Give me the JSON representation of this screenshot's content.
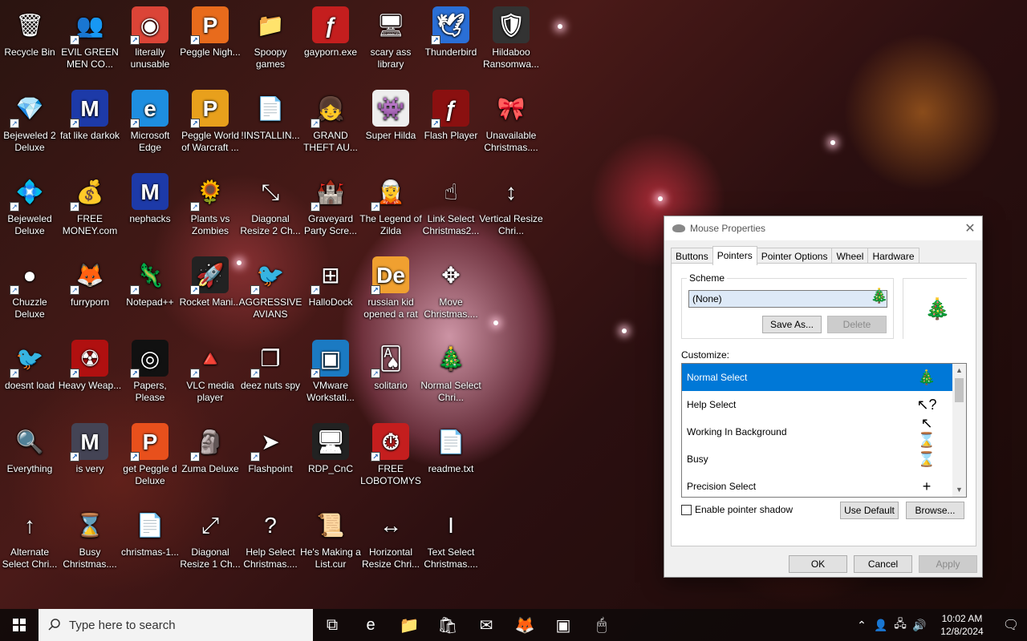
{
  "desktop": {
    "icons": [
      {
        "label": "Recycle Bin",
        "glyph": "🗑",
        "bg": "",
        "col": 0,
        "row": 0,
        "shortcut": false
      },
      {
        "label": "EVIL GREEN MEN CO...",
        "glyph": "👥",
        "bg": "",
        "col": 1,
        "row": 0,
        "shortcut": true
      },
      {
        "label": "literally unusable",
        "glyph": "◉",
        "bg": "#db4437",
        "col": 2,
        "row": 0,
        "shortcut": true
      },
      {
        "label": "Peggle Nigh...",
        "glyph": "P",
        "bg": "#e86b1c",
        "col": 3,
        "row": 0,
        "shortcut": true
      },
      {
        "label": "Spoopy games",
        "glyph": "📁",
        "bg": "",
        "col": 4,
        "row": 0,
        "shortcut": false
      },
      {
        "label": "gayporn.exe",
        "glyph": "ƒ",
        "bg": "#c41e1e",
        "col": 5,
        "row": 0,
        "shortcut": false
      },
      {
        "label": "scary ass library",
        "glyph": "🖥",
        "bg": "",
        "col": 6,
        "row": 0,
        "shortcut": false
      },
      {
        "label": "Thunderbird",
        "glyph": "🕊",
        "bg": "#2a6fd6",
        "col": 7,
        "row": 0,
        "shortcut": true
      },
      {
        "label": "Hildaboo Ransomwa...",
        "glyph": "🛡",
        "bg": "#333",
        "col": 8,
        "row": 0,
        "shortcut": false
      },
      {
        "label": "Bejeweled 2 Deluxe",
        "glyph": "💎",
        "bg": "",
        "col": 0,
        "row": 1,
        "shortcut": true
      },
      {
        "label": "fat like darkok",
        "glyph": "M",
        "bg": "#1d3aa8",
        "col": 1,
        "row": 1,
        "shortcut": true
      },
      {
        "label": "Microsoft Edge",
        "glyph": "e",
        "bg": "#1e8ee0",
        "col": 2,
        "row": 1,
        "shortcut": true
      },
      {
        "label": "Peggle World of Warcraft ...",
        "glyph": "P",
        "bg": "#e8a01c",
        "col": 3,
        "row": 1,
        "shortcut": true
      },
      {
        "label": "!INSTALLIN...",
        "glyph": "📄",
        "bg": "",
        "col": 4,
        "row": 1,
        "shortcut": false
      },
      {
        "label": "GRAND THEFT AU...",
        "glyph": "👧",
        "bg": "",
        "col": 5,
        "row": 1,
        "shortcut": true
      },
      {
        "label": "Super Hilda",
        "glyph": "👾",
        "bg": "#eee",
        "col": 6,
        "row": 1,
        "shortcut": false
      },
      {
        "label": "Flash Player",
        "glyph": "ƒ",
        "bg": "#8a1010",
        "col": 7,
        "row": 1,
        "shortcut": true
      },
      {
        "label": "Unavailable Christmas....",
        "glyph": "🎀",
        "bg": "",
        "col": 8,
        "row": 1,
        "shortcut": false
      },
      {
        "label": "Bejeweled Deluxe",
        "glyph": "💠",
        "bg": "",
        "col": 0,
        "row": 2,
        "shortcut": true
      },
      {
        "label": "FREE MONEY.com",
        "glyph": "💰",
        "bg": "",
        "col": 1,
        "row": 2,
        "shortcut": true
      },
      {
        "label": "nephacks",
        "glyph": "M",
        "bg": "#1d3aa8",
        "col": 2,
        "row": 2,
        "shortcut": false
      },
      {
        "label": "Plants vs Zombies",
        "glyph": "🌻",
        "bg": "",
        "col": 3,
        "row": 2,
        "shortcut": true
      },
      {
        "label": "Diagonal Resize 2 Ch...",
        "glyph": "⤡",
        "bg": "",
        "col": 4,
        "row": 2,
        "shortcut": false
      },
      {
        "label": "Graveyard Party Scre...",
        "glyph": "🏰",
        "bg": "",
        "col": 5,
        "row": 2,
        "shortcut": true
      },
      {
        "label": "The Legend of Zilda",
        "glyph": "🧝",
        "bg": "",
        "col": 6,
        "row": 2,
        "shortcut": true
      },
      {
        "label": "Link Select Christmas2...",
        "glyph": "☝",
        "bg": "",
        "col": 7,
        "row": 2,
        "shortcut": false
      },
      {
        "label": "Vertical Resize Chri...",
        "glyph": "↕",
        "bg": "",
        "col": 8,
        "row": 2,
        "shortcut": false
      },
      {
        "label": "Chuzzle Deluxe",
        "glyph": "●",
        "bg": "",
        "col": 0,
        "row": 3,
        "shortcut": true
      },
      {
        "label": "furryporn",
        "glyph": "🦊",
        "bg": "",
        "col": 1,
        "row": 3,
        "shortcut": true
      },
      {
        "label": "Notepad++",
        "glyph": "🦎",
        "bg": "",
        "col": 2,
        "row": 3,
        "shortcut": true
      },
      {
        "label": "Rocket Mani...",
        "glyph": "🚀",
        "bg": "#222",
        "col": 3,
        "row": 3,
        "shortcut": true
      },
      {
        "label": "AGGRESSIVE AVIANS",
        "glyph": "🐦",
        "bg": "",
        "col": 4,
        "row": 3,
        "shortcut": true
      },
      {
        "label": "HalloDock",
        "glyph": "⊞",
        "bg": "",
        "col": 5,
        "row": 3,
        "shortcut": true
      },
      {
        "label": "russian kid opened a rat",
        "glyph": "De",
        "bg": "#f0a030",
        "col": 6,
        "row": 3,
        "shortcut": true
      },
      {
        "label": "Move Christmas....",
        "glyph": "✥",
        "bg": "",
        "col": 7,
        "row": 3,
        "shortcut": false
      },
      {
        "label": "doesnt load",
        "glyph": "🐦",
        "bg": "",
        "col": 0,
        "row": 4,
        "shortcut": true
      },
      {
        "label": "Heavy Weap...",
        "glyph": "☢",
        "bg": "#b01010",
        "col": 1,
        "row": 4,
        "shortcut": true
      },
      {
        "label": "Papers, Please",
        "glyph": "◎",
        "bg": "#111",
        "col": 2,
        "row": 4,
        "shortcut": true
      },
      {
        "label": "VLC media player",
        "glyph": "🔺",
        "bg": "",
        "col": 3,
        "row": 4,
        "shortcut": true
      },
      {
        "label": "deez nuts spy",
        "glyph": "❐",
        "bg": "",
        "col": 4,
        "row": 4,
        "shortcut": true
      },
      {
        "label": "VMware Workstati...",
        "glyph": "▣",
        "bg": "#1b7ac2",
        "col": 5,
        "row": 4,
        "shortcut": true
      },
      {
        "label": "solitario",
        "glyph": "🂡",
        "bg": "",
        "col": 6,
        "row": 4,
        "shortcut": true
      },
      {
        "label": "Normal Select Chri...",
        "glyph": "🎄",
        "bg": "",
        "col": 7,
        "row": 4,
        "shortcut": false
      },
      {
        "label": "Everything",
        "glyph": "🔍",
        "bg": "",
        "col": 0,
        "row": 5,
        "shortcut": false
      },
      {
        "label": "is very",
        "glyph": "M",
        "bg": "#445",
        "col": 1,
        "row": 5,
        "shortcut": true
      },
      {
        "label": "get Peggle d Deluxe",
        "glyph": "P",
        "bg": "#e8501c",
        "col": 2,
        "row": 5,
        "shortcut": true
      },
      {
        "label": "Zuma Deluxe",
        "glyph": "🗿",
        "bg": "",
        "col": 3,
        "row": 5,
        "shortcut": true
      },
      {
        "label": "Flashpoint",
        "glyph": "➤",
        "bg": "",
        "col": 4,
        "row": 5,
        "shortcut": true
      },
      {
        "label": "RDP_CnC",
        "glyph": "🖥",
        "bg": "#222",
        "col": 5,
        "row": 5,
        "shortcut": false
      },
      {
        "label": "FREE LOBOTOMYS",
        "glyph": "⏱",
        "bg": "#c41e1e",
        "col": 6,
        "row": 5,
        "shortcut": true
      },
      {
        "label": "readme.txt",
        "glyph": "📄",
        "bg": "",
        "col": 7,
        "row": 5,
        "shortcut": false
      },
      {
        "label": "Alternate Select Chri...",
        "glyph": "↑",
        "bg": "",
        "col": 0,
        "row": 6,
        "shortcut": false
      },
      {
        "label": "Busy Christmas....",
        "glyph": "⌛",
        "bg": "",
        "col": 1,
        "row": 6,
        "shortcut": false
      },
      {
        "label": "christmas-1...",
        "glyph": "📄",
        "bg": "",
        "col": 2,
        "row": 6,
        "shortcut": false
      },
      {
        "label": "Diagonal Resize 1 Ch...",
        "glyph": "⤢",
        "bg": "",
        "col": 3,
        "row": 6,
        "shortcut": false
      },
      {
        "label": "Help Select Christmas....",
        "glyph": "?",
        "bg": "",
        "col": 4,
        "row": 6,
        "shortcut": false
      },
      {
        "label": "He's Making a List.cur",
        "glyph": "📜",
        "bg": "",
        "col": 5,
        "row": 6,
        "shortcut": false
      },
      {
        "label": "Horizontal Resize Chri...",
        "glyph": "↔",
        "bg": "",
        "col": 6,
        "row": 6,
        "shortcut": false
      },
      {
        "label": "Text Select Christmas....",
        "glyph": "I",
        "bg": "",
        "col": 7,
        "row": 6,
        "shortcut": false
      }
    ]
  },
  "dialog": {
    "title": "Mouse Properties",
    "close_glyph": "✕",
    "tabs": [
      "Buttons",
      "Pointers",
      "Pointer Options",
      "Wheel",
      "Hardware"
    ],
    "active_tab": 1,
    "scheme": {
      "label": "Scheme",
      "value": "(None)",
      "save_as": "Save As...",
      "delete": "Delete"
    },
    "customize_label": "Customize:",
    "pointers": [
      {
        "name": "Normal Select",
        "glyph": "🎄",
        "selected": true
      },
      {
        "name": "Help Select",
        "glyph": "↖?",
        "selected": false
      },
      {
        "name": "Working In Background",
        "glyph": "↖⌛",
        "selected": false
      },
      {
        "name": "Busy",
        "glyph": "⌛",
        "selected": false
      },
      {
        "name": "Precision Select",
        "glyph": "+",
        "selected": false
      }
    ],
    "enable_shadow": "Enable pointer shadow",
    "use_default": "Use Default",
    "browse": "Browse...",
    "ok": "OK",
    "cancel": "Cancel",
    "apply": "Apply"
  },
  "taskbar": {
    "search_placeholder": "Type here to search",
    "pinned": [
      {
        "name": "task-view",
        "glyph": "⧉"
      },
      {
        "name": "edge",
        "glyph": "e"
      },
      {
        "name": "file-explorer",
        "glyph": "📁"
      },
      {
        "name": "store",
        "glyph": "🛍"
      },
      {
        "name": "mail",
        "glyph": "✉"
      },
      {
        "name": "firefox",
        "glyph": "🦊"
      },
      {
        "name": "vmware",
        "glyph": "▣"
      },
      {
        "name": "mouse",
        "glyph": "🖱"
      }
    ],
    "time": "10:02 AM",
    "date": "12/8/2024",
    "colors": {
      "selection": "#0078d7",
      "taskbar": "#100a0a"
    }
  }
}
